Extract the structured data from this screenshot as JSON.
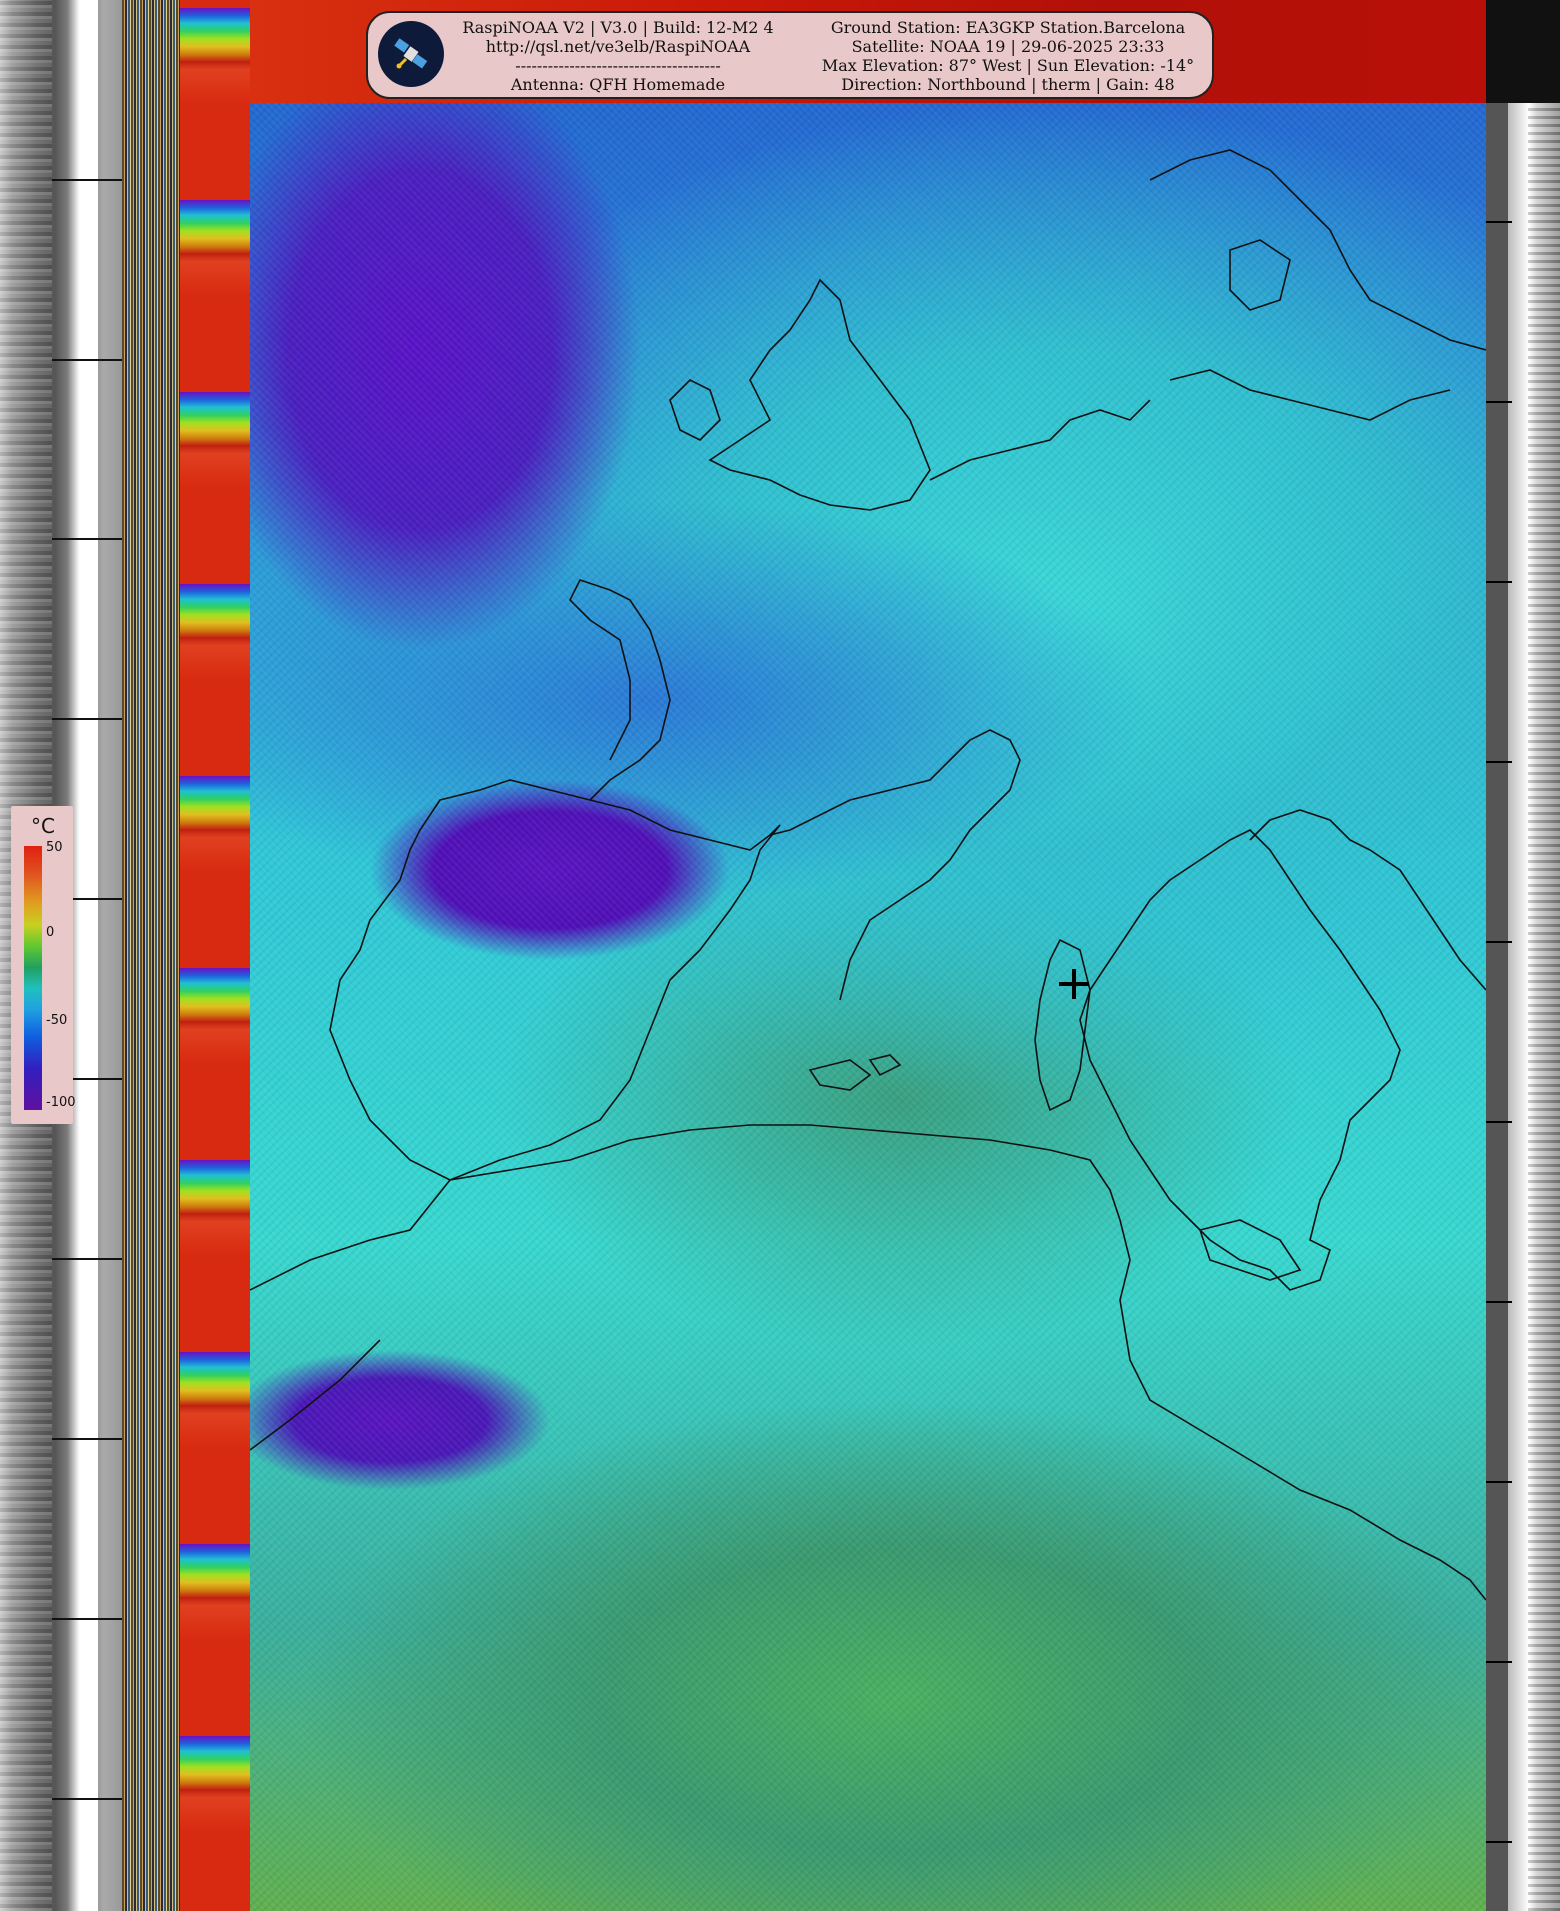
{
  "header": {
    "left_line1": "RaspiNOAA V2 | V3.0 | Build: 12-M2 4",
    "left_line2": "http://qsl.net/ve3elb/RaspiNOAA",
    "left_line3": "--------------------------------------",
    "left_line4": "Antenna: QFH Homemade",
    "right_line1": "Ground Station: EA3GKP Station.Barcelona",
    "right_line2": "Satellite: NOAA 19 | 29-06-2025 23:33",
    "right_line3": "Max Elevation: 87° West | Sun Elevation: -14°",
    "right_line4": "Direction: Northbound | therm | Gain: 48"
  },
  "legend": {
    "unit": "°C",
    "labels": [
      "50",
      "0",
      "-50",
      "-100"
    ]
  },
  "icons": {
    "logo": "satellite-icon",
    "marker": "crosshair-icon"
  }
}
